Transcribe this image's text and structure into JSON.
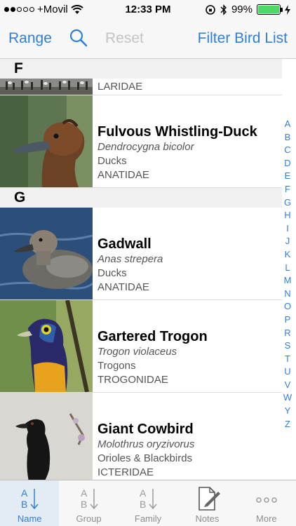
{
  "status": {
    "carrier": "+Movil",
    "time": "12:33 PM",
    "battery": "99%",
    "battery_level": 0.99,
    "signal_bars": 2
  },
  "nav": {
    "range": "Range",
    "reset": "Reset",
    "filter": "Filter Bird List"
  },
  "sections": [
    {
      "letter": "F"
    },
    {
      "letter": "G"
    }
  ],
  "rows": [
    {
      "family": "LARIDAE"
    },
    {
      "name": "Fulvous Whistling-Duck",
      "scientific": "Dendrocygna bicolor",
      "group": "Ducks",
      "family": "ANATIDAE"
    },
    {
      "name": "Gadwall",
      "scientific": "Anas strepera",
      "group": "Ducks",
      "family": "ANATIDAE"
    },
    {
      "name": "Gartered Trogon",
      "scientific": "Trogon violaceus",
      "group": "Trogons",
      "family": "TROGONIDAE"
    },
    {
      "name": "Giant Cowbird",
      "scientific": "Molothrus oryzivorus",
      "group": "Orioles & Blackbirds",
      "family": "ICTERIDAE"
    }
  ],
  "index_letters": [
    "A",
    "B",
    "C",
    "D",
    "E",
    "F",
    "G",
    "H",
    "I",
    "J",
    "K",
    "L",
    "M",
    "N",
    "O",
    "P",
    "R",
    "S",
    "T",
    "U",
    "V",
    "W",
    "Y",
    "Z"
  ],
  "tabs": [
    {
      "label": "Name",
      "icon": "sort-alpha-icon"
    },
    {
      "label": "Group",
      "icon": "sort-alpha-icon"
    },
    {
      "label": "Family",
      "icon": "sort-alpha-icon"
    },
    {
      "label": "Notes",
      "icon": "notes-pencil-icon"
    },
    {
      "label": "More",
      "icon": "more-dots-icon"
    }
  ],
  "colors": {
    "accent": "#2f7fd8",
    "disabled": "#c4c4c4",
    "battery": "#4cd964"
  }
}
